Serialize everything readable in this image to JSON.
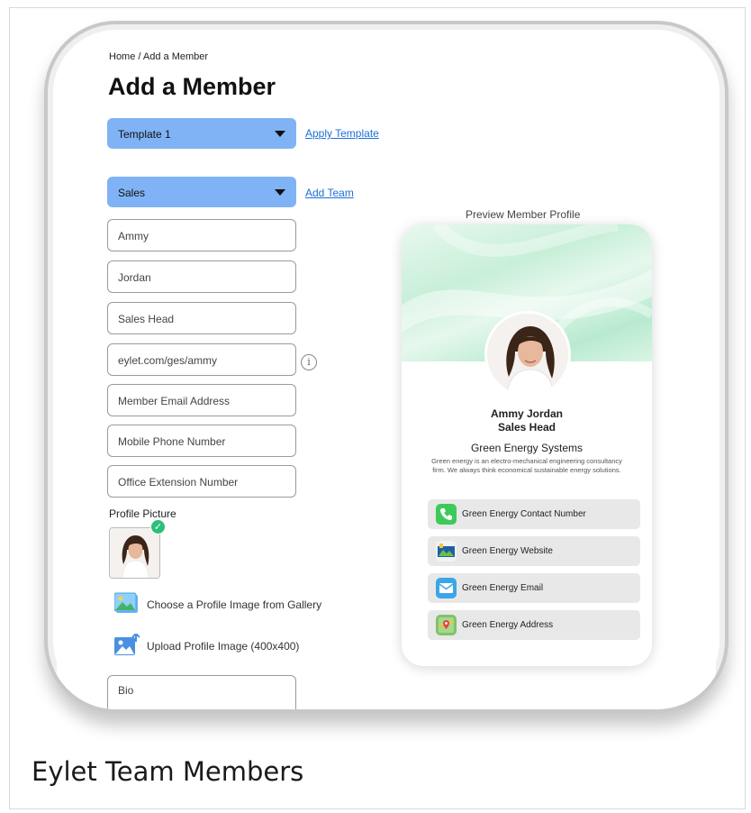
{
  "breadcrumb": "Home / Add a Member",
  "page_title": "Add a Member",
  "template_select": {
    "value": "Template 1",
    "apply_link": "Apply Template"
  },
  "team_select": {
    "value": "Sales",
    "add_link": "Add Team"
  },
  "fields": {
    "first_name": "Ammy",
    "last_name": "Jordan",
    "job_title": "Sales Head",
    "profile_url": "eylet.com/ges/ammy",
    "email_placeholder": "Member Email Address",
    "mobile_placeholder": "Mobile Phone Number",
    "office_placeholder": "Office Extension Number",
    "bio_placeholder": "Bio"
  },
  "profile_picture": {
    "label": "Profile Picture",
    "gallery_action": "Choose a Profile Image from Gallery",
    "upload_action": "Upload Profile Image (400x400)"
  },
  "preview": {
    "label": "Preview Member Profile",
    "name": "Ammy Jordan",
    "title": "Sales Head",
    "company": "Green Energy Systems",
    "description": "Green energy is an electro-mechanical engineering consultancy firm. We always think economical sustainable energy solutions.",
    "links": [
      {
        "label": "Green Energy Contact Number",
        "icon": "phone-icon"
      },
      {
        "label": "Green Energy Website",
        "icon": "website-icon"
      },
      {
        "label": "Green Energy Email",
        "icon": "email-icon"
      },
      {
        "label": "Green Energy Address",
        "icon": "map-icon"
      }
    ]
  },
  "colors": {
    "select_bg": "#7fb3f5",
    "link": "#1e6fd9",
    "check": "#2bbf7a",
    "banner": "#c8efd8"
  },
  "caption": "Eylet Team Members"
}
